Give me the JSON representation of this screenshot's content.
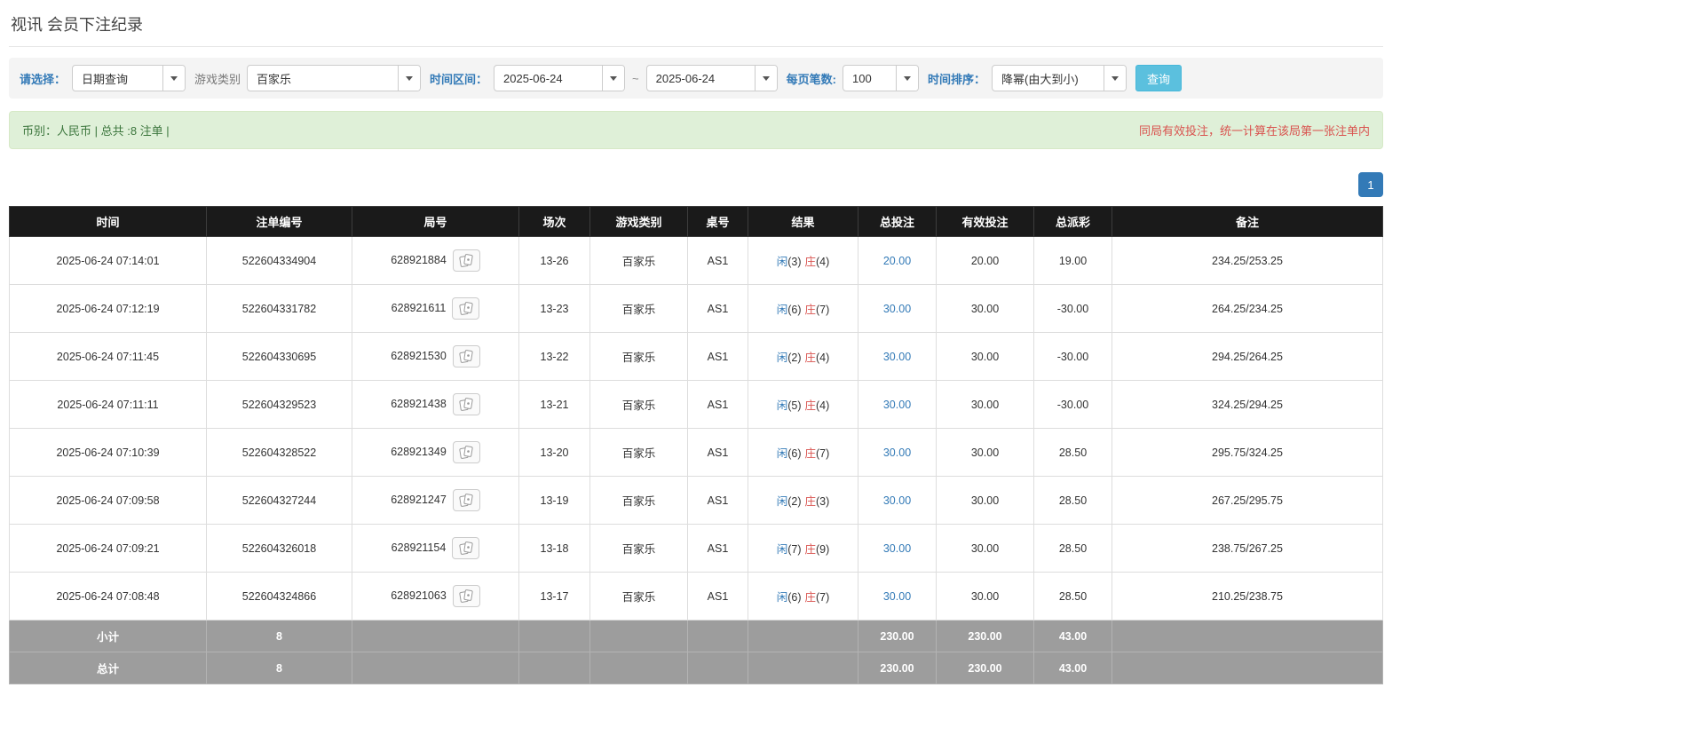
{
  "page": {
    "title": "视讯 会员下注纪录"
  },
  "filters": {
    "select_label": "请选择：",
    "select_value": "日期查询",
    "game_type_label": "游戏类别",
    "game_type_value": "百家乐",
    "range_label": "时间区间：",
    "date_from": "2025-06-24",
    "range_separator": "~",
    "date_to": "2025-06-24",
    "page_size_label": "每页笔数:",
    "page_size_value": "100",
    "sort_label": "时间排序：",
    "sort_value": "降幂(由大到小)",
    "search_button": "查询"
  },
  "summary": {
    "left_text": "币别：人民币 | 总共 :8 注单 |",
    "right_text": "同局有效投注，统一计算在该局第一张注单内"
  },
  "pagination": {
    "current_page": "1"
  },
  "table": {
    "headers": [
      "时间",
      "注单编号",
      "局号",
      "场次",
      "游戏类别",
      "桌号",
      "结果",
      "总投注",
      "有效投注",
      "总派彩",
      "备注"
    ],
    "rows": [
      {
        "time": "2025-06-24 07:14:01",
        "bet_id": "522604334904",
        "round_id": "628921884",
        "session": "13-26",
        "game": "百家乐",
        "table_no": "AS1",
        "result": {
          "p_label": "闲",
          "p_val": "(3)",
          "b_label": "庄",
          "b_val": "(4)"
        },
        "total_bet": "20.00",
        "valid_bet": "20.00",
        "payout": "19.00",
        "note": "234.25/253.25"
      },
      {
        "time": "2025-06-24 07:12:19",
        "bet_id": "522604331782",
        "round_id": "628921611",
        "session": "13-23",
        "game": "百家乐",
        "table_no": "AS1",
        "result": {
          "p_label": "闲",
          "p_val": "(6)",
          "b_label": "庄",
          "b_val": "(7)"
        },
        "total_bet": "30.00",
        "valid_bet": "30.00",
        "payout": "-30.00",
        "note": "264.25/234.25"
      },
      {
        "time": "2025-06-24 07:11:45",
        "bet_id": "522604330695",
        "round_id": "628921530",
        "session": "13-22",
        "game": "百家乐",
        "table_no": "AS1",
        "result": {
          "p_label": "闲",
          "p_val": "(2)",
          "b_label": "庄",
          "b_val": "(4)"
        },
        "total_bet": "30.00",
        "valid_bet": "30.00",
        "payout": "-30.00",
        "note": "294.25/264.25"
      },
      {
        "time": "2025-06-24 07:11:11",
        "bet_id": "522604329523",
        "round_id": "628921438",
        "session": "13-21",
        "game": "百家乐",
        "table_no": "AS1",
        "result": {
          "p_label": "闲",
          "p_val": "(5)",
          "b_label": "庄",
          "b_val": "(4)"
        },
        "total_bet": "30.00",
        "valid_bet": "30.00",
        "payout": "-30.00",
        "note": "324.25/294.25"
      },
      {
        "time": "2025-06-24 07:10:39",
        "bet_id": "522604328522",
        "round_id": "628921349",
        "session": "13-20",
        "game": "百家乐",
        "table_no": "AS1",
        "result": {
          "p_label": "闲",
          "p_val": "(6)",
          "b_label": "庄",
          "b_val": "(7)"
        },
        "total_bet": "30.00",
        "valid_bet": "30.00",
        "payout": "28.50",
        "note": "295.75/324.25"
      },
      {
        "time": "2025-06-24 07:09:58",
        "bet_id": "522604327244",
        "round_id": "628921247",
        "session": "13-19",
        "game": "百家乐",
        "table_no": "AS1",
        "result": {
          "p_label": "闲",
          "p_val": "(2)",
          "b_label": "庄",
          "b_val": "(3)"
        },
        "total_bet": "30.00",
        "valid_bet": "30.00",
        "payout": "28.50",
        "note": "267.25/295.75"
      },
      {
        "time": "2025-06-24 07:09:21",
        "bet_id": "522604326018",
        "round_id": "628921154",
        "session": "13-18",
        "game": "百家乐",
        "table_no": "AS1",
        "result": {
          "p_label": "闲",
          "p_val": "(7)",
          "b_label": "庄",
          "b_val": "(9)"
        },
        "total_bet": "30.00",
        "valid_bet": "30.00",
        "payout": "28.50",
        "note": "238.75/267.25"
      },
      {
        "time": "2025-06-24 07:08:48",
        "bet_id": "522604324866",
        "round_id": "628921063",
        "session": "13-17",
        "game": "百家乐",
        "table_no": "AS1",
        "result": {
          "p_label": "闲",
          "p_val": "(6)",
          "b_label": "庄",
          "b_val": "(7)"
        },
        "total_bet": "30.00",
        "valid_bet": "30.00",
        "payout": "28.50",
        "note": "210.25/238.75"
      }
    ],
    "subtotal": {
      "label": "小计",
      "count": "8",
      "total_bet": "230.00",
      "valid_bet": "230.00",
      "payout": "43.00"
    },
    "total": {
      "label": "总计",
      "count": "8",
      "total_bet": "230.00",
      "valid_bet": "230.00",
      "payout": "43.00"
    }
  },
  "colors": {
    "accent_blue": "#337ab7",
    "search_button_blue": "#5bc0de",
    "banker_red": "#d9534f",
    "negative_red": "#e4393c",
    "alert_bg_green": "#dff0d8",
    "alert_text_green": "#3c763d",
    "table_header_bg": "#1a1a1a",
    "table_footer_bg": "#9d9d9d"
  }
}
